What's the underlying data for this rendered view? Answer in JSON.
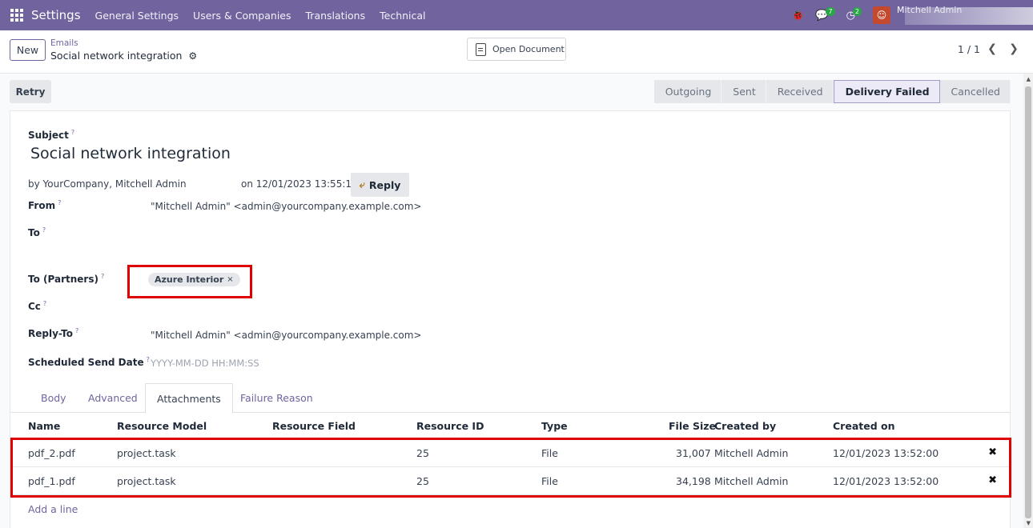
{
  "navbar": {
    "brand": "Settings",
    "menu": [
      "General Settings",
      "Users & Companies",
      "Translations",
      "Technical"
    ],
    "messages_count": "7",
    "activities_count": "2",
    "user": "Mitchell Admin"
  },
  "control": {
    "new_label": "New",
    "breadcrumb_parent": "Emails",
    "breadcrumb_current": "Social network integration",
    "open_document_label": "Open Document",
    "pager": "1 / 1"
  },
  "statusbar": {
    "retry_label": "Retry",
    "stages": [
      "Outgoing",
      "Sent",
      "Received",
      "Delivery Failed",
      "Cancelled"
    ],
    "active_stage": "Delivery Failed"
  },
  "form": {
    "subject_label": "Subject",
    "subject": "Social network integration",
    "by": "by  YourCompany, Mitchell Admin",
    "on": "on 12/01/2023 13:55:16",
    "reply_label": "Reply",
    "from_label": "From",
    "from": "\"Mitchell Admin\" <admin@yourcompany.example.com>",
    "to_label": "To",
    "to_partners_label": "To (Partners)",
    "partner_tag": "Azure Interior",
    "cc_label": "Cc",
    "reply_to_label": "Reply-To",
    "reply_to": "\"Mitchell Admin\" <admin@yourcompany.example.com>",
    "scheduled_label": "Scheduled Send Date",
    "scheduled_placeholder": "YYYY-MM-DD HH:MM:SS"
  },
  "tabs": [
    "Body",
    "Advanced",
    "Attachments",
    "Failure Reason"
  ],
  "active_tab": "Attachments",
  "table": {
    "headers": [
      "Name",
      "Resource Model",
      "Resource Field",
      "Resource ID",
      "Type",
      "File Size",
      "Created by",
      "Created on"
    ],
    "rows": [
      {
        "name": "pdf_2.pdf",
        "model": "project.task",
        "field": "",
        "res_id": "25",
        "type": "File",
        "size": "31,007",
        "created_by": "Mitchell Admin",
        "created_on": "12/01/2023 13:52:00"
      },
      {
        "name": "pdf_1.pdf",
        "model": "project.task",
        "field": "",
        "res_id": "25",
        "type": "File",
        "size": "34,198",
        "created_by": "Mitchell Admin",
        "created_on": "12/01/2023 13:52:00"
      }
    ],
    "add_line": "Add a line"
  },
  "colors": {
    "navbar": "#71639e",
    "accent": "#71639e",
    "highlight": "#e00000"
  }
}
